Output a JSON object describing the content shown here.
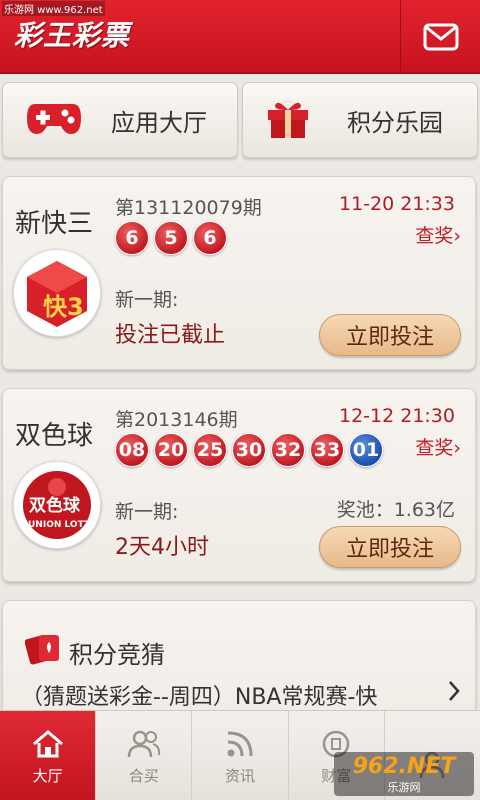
{
  "header": {
    "watermark": "乐游网 www.962.net",
    "logo": "彩王彩票"
  },
  "top_buttons": {
    "app_hall": "应用大厅",
    "points_park": "积分乐园"
  },
  "cards": [
    {
      "name": "新快三",
      "logo_text": "快3",
      "issue": "第131120079期",
      "draw_time": "11-20 21:33",
      "check": "查奖",
      "balls": [
        "6",
        "5",
        "6"
      ],
      "next_label": "新一期:",
      "pool": "",
      "next_status": "投注已截止",
      "bet": "立即投注"
    },
    {
      "name": "双色球",
      "logo_text": "双色球",
      "logo_sub": "UNION LOTTO",
      "issue": "第2013146期",
      "draw_time": "12-12 21:30",
      "check": "查奖",
      "red_balls": [
        "08",
        "20",
        "25",
        "30",
        "32",
        "33"
      ],
      "blue_balls": [
        "01"
      ],
      "next_label": "新一期:",
      "pool": "奖池：1.63亿",
      "next_status": "2天4小时",
      "bet": "立即投注"
    }
  ],
  "guess": {
    "title": "积分竞猜",
    "desc": "（猜题送彩金--周四）NBA常规赛-快"
  },
  "bottom_nav": [
    {
      "label": "大厅",
      "active": true
    },
    {
      "label": "合买",
      "active": false
    },
    {
      "label": "资讯",
      "active": false
    },
    {
      "label": "财富",
      "active": false
    },
    {
      "label": "",
      "active": false
    }
  ],
  "brand": {
    "line1": "962.NET",
    "line2": "乐游网"
  },
  "colors": {
    "primary_red": "#d21c27",
    "ball_blue": "#1d4fb0",
    "bet_button": "#e7b98a"
  }
}
